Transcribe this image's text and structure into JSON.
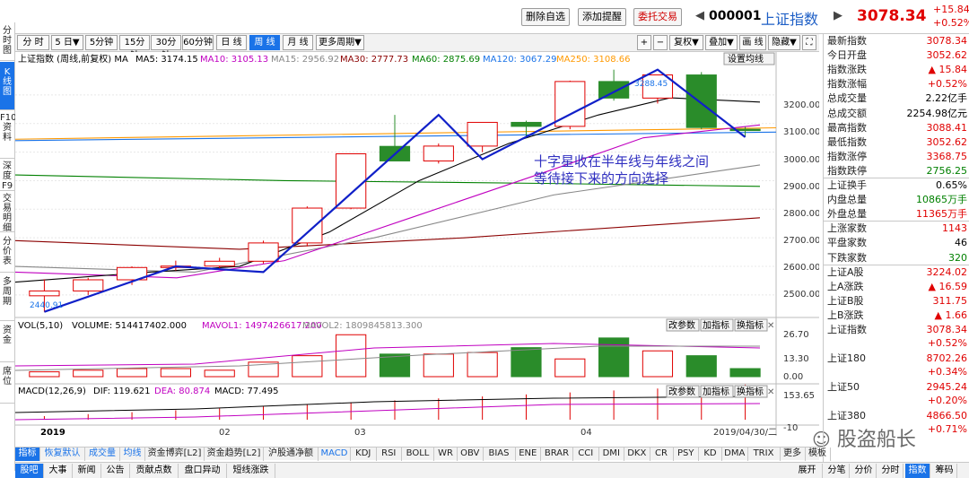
{
  "top": {
    "btn_delete": "删除自选",
    "btn_add_alert": "添加提醒",
    "btn_order": "委托交易",
    "code": "000001",
    "name": "上证指数",
    "price": "3078.34",
    "chg_abs": "+15.84",
    "chg_pct": "+0.52%"
  },
  "left_tabs": [
    {
      "label": "分时图"
    },
    {
      "label": "K线图"
    },
    {
      "label": "F10资料"
    },
    {
      "label": "深度F9"
    },
    {
      "label": "交易明细"
    },
    {
      "label": "分价表"
    },
    {
      "label": "多周期"
    },
    {
      "label": "资金"
    },
    {
      "label": "席位"
    }
  ],
  "periods": [
    "分 时",
    "5 日▼",
    "5分钟",
    "15分钟",
    "30分钟",
    "60分钟",
    "日 线",
    "周 线",
    "月 线",
    "更多周期▼"
  ],
  "tools": {
    "plus": "+",
    "minus": "−",
    "fuquan": "复权▼",
    "diejia": "叠加▼",
    "huaxian": "画 线",
    "yincang": "隐藏▼",
    "fullscreen": "⛶"
  },
  "legend": {
    "label": "上证指数 (周线,前复权) MA",
    "ma5": "MA5: 3174.15",
    "ma10": "MA10: 3105.13",
    "ma15": "MA15: 2956.92",
    "ma30": "MA30: 2777.73",
    "ma60": "MA60: 2875.69",
    "ma120": "MA120: 3067.29",
    "ma250": "MA250: 3108.66",
    "settings": "设置均线"
  },
  "annotation": {
    "line1": "十字星收在半年线与年线之间",
    "line2": "等待接下来的方向选择"
  },
  "price_axis": [
    "3200.00",
    "3100.00",
    "3000.00",
    "2900.00",
    "2800.00",
    "2700.00",
    "2600.00",
    "2500.00"
  ],
  "low_mark": "2440.91",
  "high_mark": "3288.45",
  "vol": {
    "title": "VOL(5,10)",
    "volume": "VOLUME: 514417402.000",
    "mavol1": "MAVOL1: 1497426617.200",
    "mavol2": "MAVOL2: 1809845813.300",
    "axis": [
      "26.70",
      "13.30",
      "0.00"
    ],
    "btn_params": "改参数",
    "btn_add": "加指标",
    "btn_switch": "换指标"
  },
  "macd": {
    "title": "MACD(12,26,9)",
    "dif": "DIF: 119.621",
    "dea": "DEA: 80.874",
    "macd": "MACD: 77.495",
    "axis": [
      "153.65",
      "-10"
    ],
    "btn_params": "改参数",
    "btn_add": "加指标",
    "btn_switch": "换指标"
  },
  "time_axis": [
    "2019",
    "02",
    "03",
    "04"
  ],
  "date_stamp": "2019/04/30/二",
  "indicator_tabs": [
    "指标",
    "恢复默认",
    "成交量",
    "均线",
    "资金博弈[L2]",
    "资金趋势[L2]",
    "沪股通净额",
    "MACD",
    "KDJ",
    "RSI",
    "BOLL",
    "WR",
    "OBV",
    "BIAS",
    "ENE",
    "BRAR",
    "CCI",
    "DMI",
    "DKX",
    "CR",
    "PSY",
    "KD",
    "DMA",
    "TRIX",
    "更多",
    "模板"
  ],
  "bottom_tabs": [
    "股吧",
    "大事",
    "新闻",
    "公告",
    "贡献点数",
    "盘口异动",
    "短线涨跌"
  ],
  "bottom_right": [
    "展开",
    "分笔",
    "分价",
    "分时",
    "指数",
    "筹码"
  ],
  "right_panel": [
    {
      "k": "最新指数",
      "v": "3078.34",
      "c": "#e00000"
    },
    {
      "k": "今日开盘",
      "v": "3052.62",
      "c": "#e00000"
    },
    {
      "k": "指数涨跌",
      "v": "▲ 15.84",
      "c": "#e00000"
    },
    {
      "k": "指数涨幅",
      "v": "+0.52%",
      "c": "#e00000"
    },
    {
      "k": "总成交量",
      "v": "2.22亿手",
      "c": "#000000"
    },
    {
      "k": "总成交额",
      "v": "2254.98亿元",
      "c": "#000000"
    },
    {
      "k": "最高指数",
      "v": "3088.41",
      "c": "#e00000"
    },
    {
      "k": "最低指数",
      "v": "3052.62",
      "c": "#e00000"
    },
    {
      "k": "指数涨停",
      "v": "3368.75",
      "c": "#e00000"
    },
    {
      "k": "指数跌停",
      "v": "2756.25",
      "c": "#008000"
    },
    {
      "k": "上证换手",
      "v": "0.65%",
      "c": "#000000"
    },
    {
      "k": "内盘总量",
      "v": "10865万手",
      "c": "#008000"
    },
    {
      "k": "外盘总量",
      "v": "11365万手",
      "c": "#e00000"
    },
    {
      "k": "上涨家数",
      "v": "1143",
      "c": "#e00000"
    },
    {
      "k": "平盘家数",
      "v": "46",
      "c": "#000000"
    },
    {
      "k": "下跌家数",
      "v": "320",
      "c": "#008000"
    },
    {
      "k": "上证A股",
      "v": "3224.02",
      "c": "#e00000"
    },
    {
      "k": "上A涨跌",
      "v": "▲ 16.59",
      "c": "#e00000"
    },
    {
      "k": "上证B股",
      "v": "311.75",
      "c": "#e00000"
    },
    {
      "k": "上B涨跌",
      "v": "▲ 1.66",
      "c": "#e00000"
    }
  ],
  "right_indices": [
    {
      "k": "上证指数",
      "v1": "3078.34",
      "v2": "+0.52%"
    },
    {
      "k": "上证180",
      "v1": "8702.26",
      "v2": "+0.34%"
    },
    {
      "k": "上证50",
      "v1": "2945.24",
      "v2": "+0.20%"
    },
    {
      "k": "上证380",
      "v1": "4866.50",
      "v2": "+0.71%"
    }
  ],
  "watermark": "股盗船长",
  "chart_data": {
    "type": "candlestick",
    "title": "上证指数 (周线,前复权)",
    "x": [
      "2019-01-04",
      "2019-01-11",
      "2019-01-18",
      "2019-01-25",
      "2019-02-01",
      "2019-02-15",
      "2019-02-22",
      "2019-03-01",
      "2019-03-08",
      "2019-03-15",
      "2019-03-22",
      "2019-03-29",
      "2019-04-04",
      "2019-04-12",
      "2019-04-19",
      "2019-04-26",
      "2019-04-30"
    ],
    "ohlc": [
      [
        2497,
        2555,
        2440.91,
        2514
      ],
      [
        2514,
        2560,
        2500,
        2553
      ],
      [
        2553,
        2600,
        2535,
        2596
      ],
      [
        2596,
        2620,
        2585,
        2601
      ],
      [
        2601,
        2630,
        2590,
        2618
      ],
      [
        2618,
        2690,
        2610,
        2682
      ],
      [
        2682,
        2810,
        2670,
        2804
      ],
      [
        2804,
        2995,
        2800,
        2994
      ],
      [
        3020,
        3130,
        2970,
        2969
      ],
      [
        2969,
        3030,
        2960,
        3021
      ],
      [
        3021,
        3100,
        3000,
        3104
      ],
      [
        3104,
        3110,
        3050,
        3090
      ],
      [
        3090,
        3250,
        3080,
        3247
      ],
      [
        3247,
        3288.45,
        3180,
        3189
      ],
      [
        3189,
        3270,
        3170,
        3270
      ],
      [
        3270,
        3280,
        3080,
        3086
      ],
      [
        3080,
        3088.41,
        3052.62,
        3078.34
      ]
    ],
    "volume_bars": [
      3,
      4,
      5,
      5,
      4,
      9,
      13,
      26,
      14,
      14,
      15,
      18,
      11,
      24,
      16,
      13,
      5
    ],
    "ylim": [
      2440,
      3300
    ]
  }
}
